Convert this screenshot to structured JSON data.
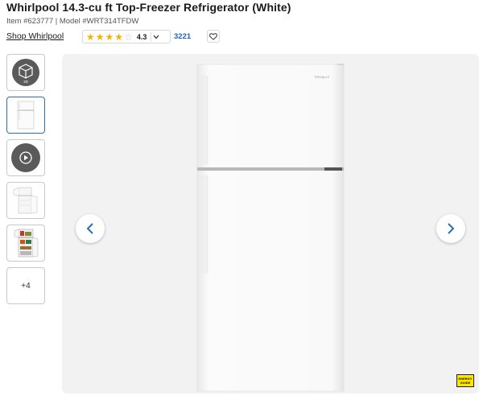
{
  "product": {
    "title": "Whirlpool 14.3-cu ft Top-Freezer Refrigerator (White)",
    "meta": "Item #623777 | Model #WRT314TFDW",
    "shop_link": "Shop Whirlpool"
  },
  "rating": {
    "value": "4.3",
    "stars_filled": 4,
    "stars_total": 5,
    "review_count": "3221"
  },
  "thumbnails": [
    {
      "name": "thumb-3d-view",
      "icon": "3d-cube-icon",
      "badge": "3D"
    },
    {
      "name": "thumb-front-image",
      "icon": "refrigerator-icon"
    },
    {
      "name": "thumb-video",
      "icon": "play-icon"
    },
    {
      "name": "thumb-open-door",
      "icon": "refrigerator-open-icon"
    },
    {
      "name": "thumb-interior",
      "icon": "refrigerator-interior-icon"
    },
    {
      "name": "thumb-more",
      "label": "+4"
    }
  ],
  "gallery": {
    "brand_badge": "Whirlpool",
    "energy_label": "ENERGY GUIDE"
  },
  "colors": {
    "accent": "#2a6fb3",
    "star": "#f3b100",
    "link": "#1a66c2",
    "gallery_bg": "#f2f2f2",
    "energy_yellow": "#ffe600"
  }
}
